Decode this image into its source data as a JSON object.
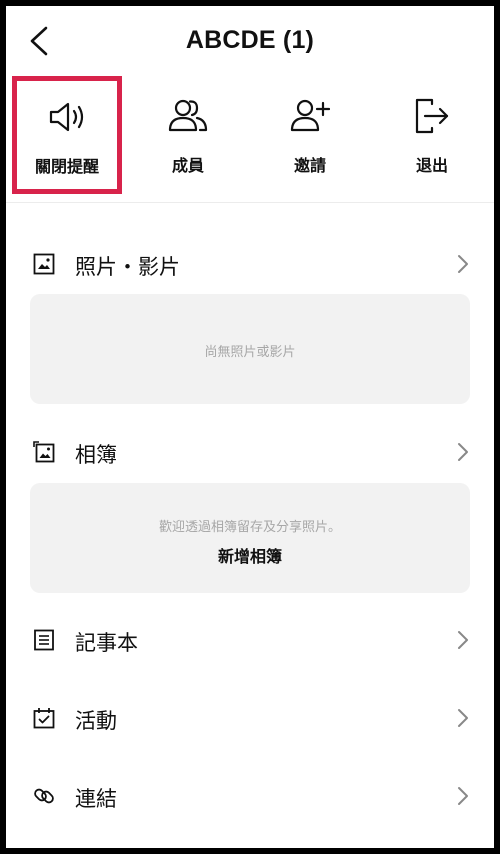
{
  "header": {
    "title": "ABCDE (1)"
  },
  "actions": [
    {
      "label": "關閉提醒"
    },
    {
      "label": "成員"
    },
    {
      "label": "邀請"
    },
    {
      "label": "退出"
    }
  ],
  "sections": {
    "photos": {
      "label": "照片・影片",
      "empty_text": "尚無照片或影片"
    },
    "albums": {
      "label": "相簿",
      "hint_text": "歡迎透過相簿留存及分享照片。",
      "add_label": "新增相簿"
    },
    "notes": {
      "label": "記事本"
    },
    "events": {
      "label": "活動"
    },
    "links": {
      "label": "連結"
    }
  },
  "colors": {
    "highlight": "#d8234b",
    "card_bg": "#f2f2f2",
    "muted_text": "#a7a7a7"
  }
}
